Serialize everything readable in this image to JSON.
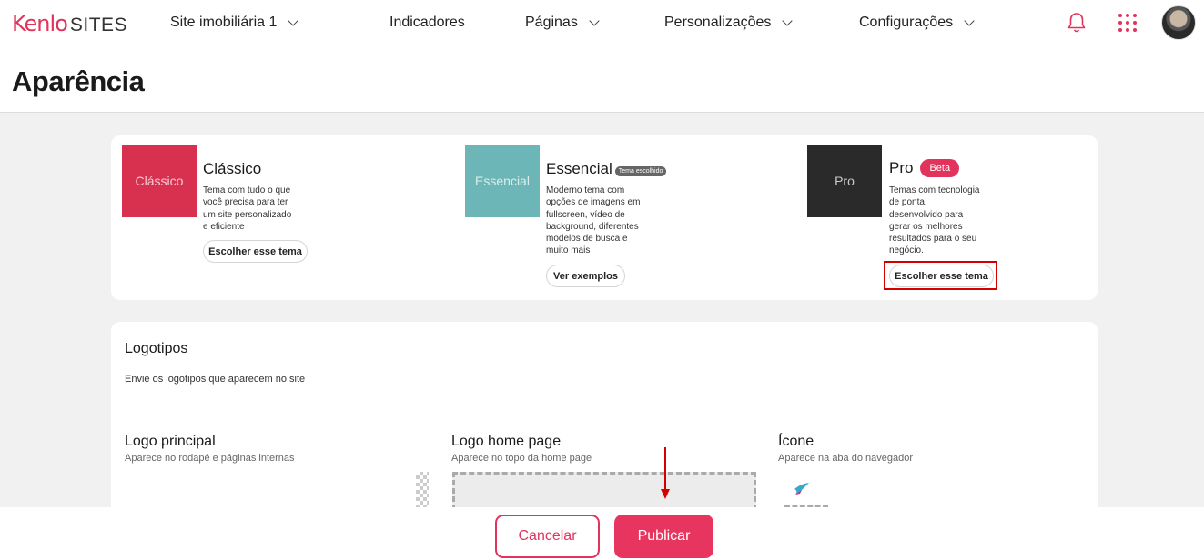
{
  "header": {
    "logo_brand": "Kenlo",
    "logo_product": "SITES",
    "site_selector": "Site imobiliária 1",
    "nav": {
      "indicators": "Indicadores",
      "pages": "Páginas",
      "personalizations": "Personalizações",
      "settings": "Configurações"
    },
    "icons": [
      "bell-icon",
      "apps-grid-icon",
      "user-avatar"
    ]
  },
  "page": {
    "title": "Aparência"
  },
  "themes": {
    "classic": {
      "thumb_label": "Clássico",
      "name": "Clássico",
      "description": "Tema com tudo o que você precisa para ter um site personalizado e eficiente",
      "button": "Escolher esse tema",
      "color": "#d8314f"
    },
    "essential": {
      "thumb_label": "Essencial",
      "name": "Essencial",
      "badge": "Tema escolhido",
      "description": "Moderno tema com opções de imagens em fullscreen, vídeo de background, diferentes modelos de busca e muito mais",
      "button": "Ver exemplos",
      "color": "#6cb6b7"
    },
    "pro": {
      "thumb_label": "Pro",
      "name": "Pro",
      "badge": "Beta",
      "description": "Temas com tecnologia de ponta, desenvolvido para gerar os melhores resultados para o seu negócio.",
      "button": "Escolher esse tema",
      "color": "#2a2a2a"
    }
  },
  "logos": {
    "title": "Logotipos",
    "subtitle": "Envie os logotipos que aparecem no site",
    "main": {
      "title": "Logo principal",
      "subtitle": "Aparece no rodapé e páginas internas"
    },
    "home": {
      "title": "Logo home page",
      "subtitle": "Aparece no topo da home page"
    },
    "icon": {
      "title": "Ícone",
      "subtitle": "Aparece na aba do navegador"
    }
  },
  "footer": {
    "cancel": "Cancelar",
    "publish": "Publicar"
  },
  "colors": {
    "accent": "#e2335c",
    "highlight": "#d40000"
  }
}
